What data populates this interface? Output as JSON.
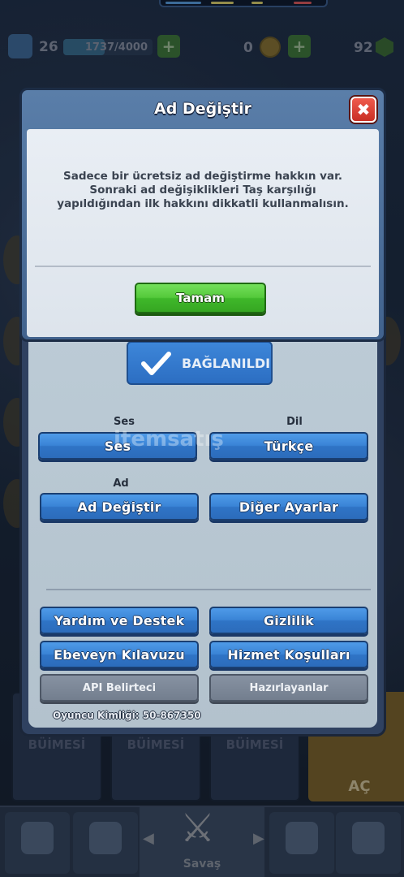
{
  "hud": {
    "level": "26",
    "xp": "1737/4000",
    "gold": "0",
    "gems": "92"
  },
  "background": {
    "card_labels": [
      "BÜİMESİ",
      "BÜİMESİ",
      "BÜİMESİ"
    ],
    "open_label": "AÇ",
    "battle_label": "Savaş"
  },
  "settings": {
    "connected_label": "BAĞLANILDI",
    "sound_heading": "Ses",
    "sound_button": "Ses",
    "language_heading": "Dil",
    "language_button": "Türkçe",
    "name_heading": "Ad",
    "change_name_button": "Ad Değiştir",
    "other_settings_button": "Diğer Ayarlar",
    "help_button": "Yardım ve Destek",
    "privacy_button": "Gizlilik",
    "parents_guide_button": "Ebeveyn Kılavuzu",
    "terms_button": "Hizmet Koşulları",
    "api_token_button": "API Belirteci",
    "credits_button": "Hazırlayanlar",
    "player_id": "Oyuncu Kimliği: 50-867350"
  },
  "watermark": "itemsatış",
  "modal": {
    "title": "Ad Değiştir",
    "message": "Sadece bir ücretsiz ad değiştirme hakkın var. Sonraki ad değişiklikleri Taş karşılığı yapıldığından ilk hakkını dikkatli kullanmalısın.",
    "ok_button": "Tamam"
  },
  "colors": {
    "primary_button": "#3a84d6",
    "confirm_button": "#54c93b",
    "close_button": "#d93a2e",
    "modal_header": "#4f7099"
  }
}
